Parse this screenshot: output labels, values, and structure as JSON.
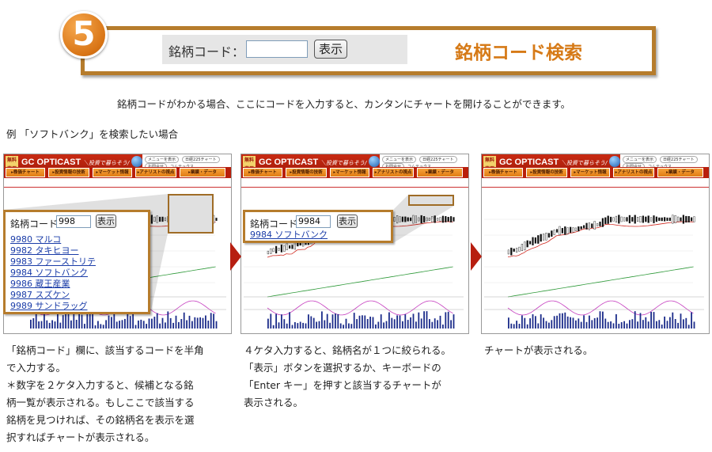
{
  "step": {
    "number": "5",
    "search_label": "銘柄コード：",
    "search_input_value": "",
    "search_button": "表示",
    "title": "銘柄コード検索"
  },
  "intro": "銘柄コードがわかる場合、ここにコードを入力すると、カンタンにチャートを開けることができます。",
  "example": "例 「ソフトバンク」を検索したい場合",
  "site": {
    "free_badge": "無料専用",
    "brand": "GC OPTICAST",
    "tagline": "＼投資で暮らそう/",
    "new_badge": "NEW!",
    "company": "コムテックス",
    "header_links": [
      "メニューを表示",
      "日経225チャート",
      "お問合せ"
    ],
    "menu": [
      "株価チャート",
      "投資情報の技術",
      "マーケット情報",
      "アナリストの視点",
      "業績・データ"
    ]
  },
  "panel1": {
    "popup_label": "銘柄コード：",
    "popup_input": "998",
    "popup_button": "表示",
    "suggestions": [
      "9980 マルコ",
      "9982 タキヒヨー",
      "9983 ファーストリテ",
      "9984 ソフトバンク",
      "9986 蔵王産業",
      "9987 スズケン",
      "9989 サンドラッグ"
    ]
  },
  "panel2": {
    "popup_label": "銘柄コード：",
    "popup_input": "9984",
    "popup_button": "表示",
    "suggestions": [
      "9984 ソフトバンク"
    ]
  },
  "captions": {
    "c1": [
      "「銘柄コード」欄に、該当するコードを半角",
      "で入力する。",
      "＊数字を２ケタ入力すると、候補となる銘",
      "柄一覧が表示される。もしここで該当する",
      "銘柄を見つければ、その銘柄名を表示を選",
      "択すればチャートが表示される。"
    ],
    "c2": [
      "４ケタ入力すると、銘柄名が１つに絞られる。",
      "「表示」ボタンを選択するか、キーボードの",
      "「Enter キー」を押すと該当するチャートが",
      "表示される。"
    ],
    "c3": [
      "チャートが表示される。"
    ]
  },
  "colors": {
    "accent_orange": "#d67a17",
    "frame_brown": "#b67c2c",
    "brand_red": "#b91f0b",
    "link_blue": "#1a3ca8"
  }
}
